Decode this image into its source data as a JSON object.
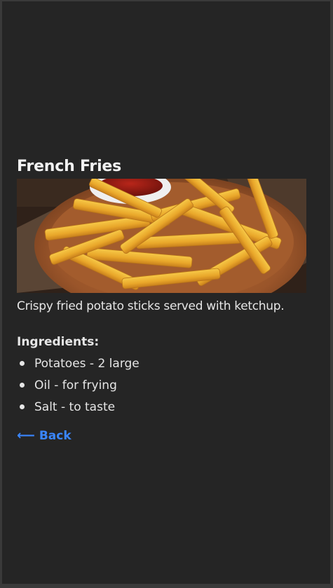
{
  "recipe": {
    "title": "French Fries",
    "image_alt": "French fries in a wooden bowl with ketchup",
    "description": "Crispy fried potato sticks served with ketchup.",
    "ingredients_heading": "Ingredients:",
    "ingredients": [
      "Potatoes - 2 large",
      "Oil - for frying",
      "Salt - to taste"
    ]
  },
  "nav": {
    "back_arrow": "⟵",
    "back_label": "Back"
  },
  "colors": {
    "background": "#252525",
    "text": "#e6e6e6",
    "link": "#3a86ff"
  }
}
